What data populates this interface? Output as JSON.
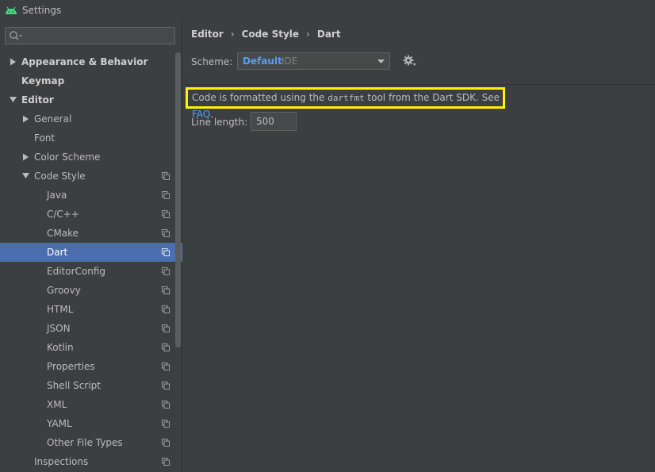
{
  "window": {
    "title": "Settings"
  },
  "search": {
    "placeholder": ""
  },
  "tree": [
    {
      "label": "Appearance & Behavior",
      "bold": true,
      "indent": 0,
      "arrow": "right",
      "copy": false,
      "selected": false
    },
    {
      "label": "Keymap",
      "bold": true,
      "indent": 0,
      "arrow": "",
      "copy": false,
      "selected": false
    },
    {
      "label": "Editor",
      "bold": true,
      "indent": 0,
      "arrow": "down",
      "copy": false,
      "selected": false
    },
    {
      "label": "General",
      "bold": false,
      "indent": 1,
      "arrow": "right",
      "copy": false,
      "selected": false
    },
    {
      "label": "Font",
      "bold": false,
      "indent": 1,
      "arrow": "",
      "copy": false,
      "selected": false
    },
    {
      "label": "Color Scheme",
      "bold": false,
      "indent": 1,
      "arrow": "right",
      "copy": false,
      "selected": false
    },
    {
      "label": "Code Style",
      "bold": false,
      "indent": 1,
      "arrow": "down",
      "copy": true,
      "selected": false
    },
    {
      "label": "Java",
      "bold": false,
      "indent": 2,
      "arrow": "",
      "copy": true,
      "selected": false
    },
    {
      "label": "C/C++",
      "bold": false,
      "indent": 2,
      "arrow": "",
      "copy": true,
      "selected": false
    },
    {
      "label": "CMake",
      "bold": false,
      "indent": 2,
      "arrow": "",
      "copy": true,
      "selected": false
    },
    {
      "label": "Dart",
      "bold": false,
      "indent": 2,
      "arrow": "",
      "copy": true,
      "selected": true
    },
    {
      "label": "EditorConfig",
      "bold": false,
      "indent": 2,
      "arrow": "",
      "copy": true,
      "selected": false
    },
    {
      "label": "Groovy",
      "bold": false,
      "indent": 2,
      "arrow": "",
      "copy": true,
      "selected": false
    },
    {
      "label": "HTML",
      "bold": false,
      "indent": 2,
      "arrow": "",
      "copy": true,
      "selected": false
    },
    {
      "label": "JSON",
      "bold": false,
      "indent": 2,
      "arrow": "",
      "copy": true,
      "selected": false
    },
    {
      "label": "Kotlin",
      "bold": false,
      "indent": 2,
      "arrow": "",
      "copy": true,
      "selected": false
    },
    {
      "label": "Properties",
      "bold": false,
      "indent": 2,
      "arrow": "",
      "copy": true,
      "selected": false
    },
    {
      "label": "Shell Script",
      "bold": false,
      "indent": 2,
      "arrow": "",
      "copy": true,
      "selected": false
    },
    {
      "label": "XML",
      "bold": false,
      "indent": 2,
      "arrow": "",
      "copy": true,
      "selected": false
    },
    {
      "label": "YAML",
      "bold": false,
      "indent": 2,
      "arrow": "",
      "copy": true,
      "selected": false
    },
    {
      "label": "Other File Types",
      "bold": false,
      "indent": 2,
      "arrow": "",
      "copy": true,
      "selected": false
    },
    {
      "label": "Inspections",
      "bold": false,
      "indent": 1,
      "arrow": "",
      "copy": true,
      "selected": false
    }
  ],
  "breadcrumb": [
    "Editor",
    "Code Style",
    "Dart"
  ],
  "scheme": {
    "label": "Scheme:",
    "name": "Default",
    "kind": "IDE"
  },
  "notice": {
    "prefix": "Code is formatted using the ",
    "tool": "dartfmt",
    "middle": " tool from the Dart SDK. See ",
    "link": "FAQ",
    "suffix": "."
  },
  "line_length": {
    "label": "Line length:",
    "value": "500"
  },
  "colors": {
    "background": "#3c3f41",
    "selection": "#4b6eaf",
    "link": "#589df6",
    "highlight_box": "#fff200",
    "android_green": "#3ddc84"
  }
}
